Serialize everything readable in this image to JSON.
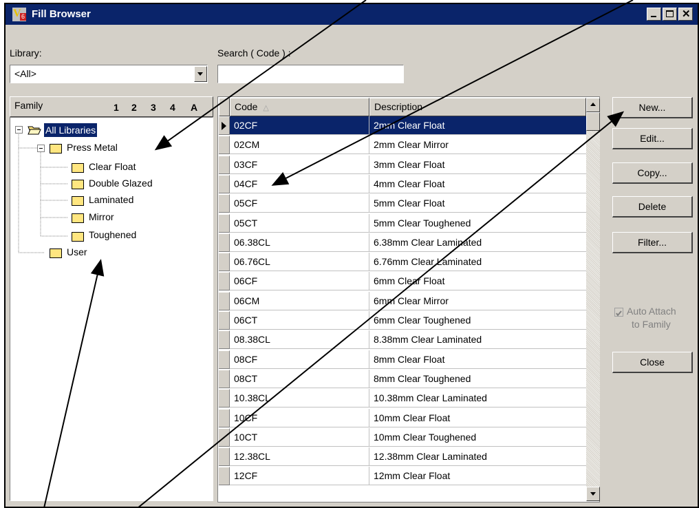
{
  "window": {
    "title": "Fill Browser"
  },
  "library": {
    "label": "Library:",
    "value": "<All>"
  },
  "search": {
    "label": "Search ( Code ) :",
    "value": ""
  },
  "tree": {
    "header_label": "Family",
    "sort_keys": [
      "1",
      "2",
      "3",
      "4",
      "A"
    ],
    "root": "All Libraries",
    "press_metal": "Press Metal",
    "children": [
      "Clear Float",
      "Double Glazed",
      "Laminated",
      "Mirror",
      "Toughened"
    ],
    "user": "User"
  },
  "grid": {
    "col_code": "Code",
    "col_desc": "Description",
    "rows": [
      {
        "code": "02CF",
        "desc": "2mm Clear Float"
      },
      {
        "code": "02CM",
        "desc": "2mm Clear Mirror"
      },
      {
        "code": "03CF",
        "desc": "3mm Clear Float"
      },
      {
        "code": "04CF",
        "desc": "4mm Clear Float"
      },
      {
        "code": "05CF",
        "desc": "5mm Clear Float"
      },
      {
        "code": "05CT",
        "desc": "5mm Clear Toughened"
      },
      {
        "code": "06.38CL",
        "desc": "6.38mm Clear Laminated"
      },
      {
        "code": "06.76CL",
        "desc": "6.76mm Clear Laminated"
      },
      {
        "code": "06CF",
        "desc": "6mm Clear Float"
      },
      {
        "code": "06CM",
        "desc": "6mm Clear Mirror"
      },
      {
        "code": "06CT",
        "desc": "6mm Clear Toughened"
      },
      {
        "code": "08.38CL",
        "desc": "8.38mm Clear Laminated"
      },
      {
        "code": "08CF",
        "desc": "8mm Clear Float"
      },
      {
        "code": "08CT",
        "desc": "8mm Clear Toughened"
      },
      {
        "code": "10.38CL",
        "desc": "10.38mm Clear Laminated"
      },
      {
        "code": "10CF",
        "desc": "10mm Clear Float"
      },
      {
        "code": "10CT",
        "desc": "10mm Clear Toughened"
      },
      {
        "code": "12.38CL",
        "desc": "12.38mm Clear Laminated"
      },
      {
        "code": "12CF",
        "desc": "12mm Clear Float"
      }
    ]
  },
  "buttons": {
    "new": "New...",
    "edit": "Edit...",
    "copy": "Copy...",
    "delete": "Delete",
    "filter": "Filter...",
    "close": "Close"
  },
  "auto_attach": {
    "line1": "Auto Attach",
    "line2": "to Family",
    "checked": true
  },
  "colors": {
    "titlebar": "#0a246a",
    "selection": "#0a246a",
    "face": "#d4d0c8"
  }
}
